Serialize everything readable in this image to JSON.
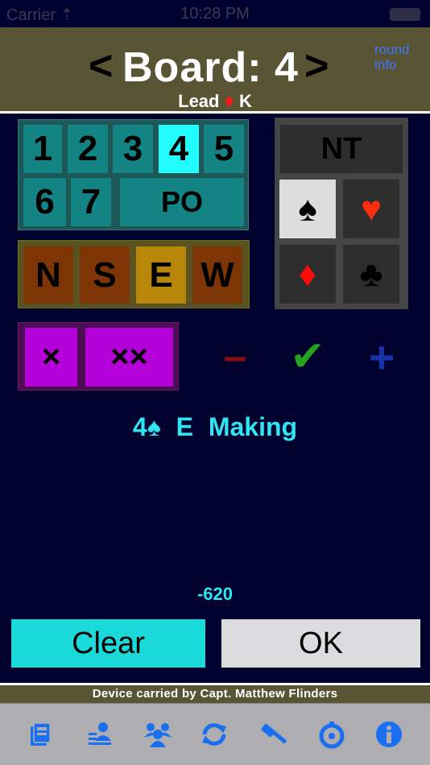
{
  "status_bar": {
    "carrier": "Carrier ⇡",
    "time": "10:28 PM"
  },
  "header": {
    "prev": "<",
    "title": "Board: 4",
    "next": ">",
    "round_info_line1": "round",
    "round_info_line2": "info",
    "lead_label": "Lead",
    "lead_suit": "♦",
    "lead_card": "K"
  },
  "levels": [
    "1",
    "2",
    "3",
    "4",
    "5",
    "6",
    "7"
  ],
  "selected_level": "4",
  "pass_out": "PO",
  "seats": [
    "N",
    "S",
    "E",
    "W"
  ],
  "selected_seat": "E",
  "strains": {
    "nt": "NT",
    "spade": "♠",
    "heart": "♥",
    "diamond": "♦",
    "club": "♣"
  },
  "selected_strain": "spade",
  "doubles": {
    "double": "×",
    "redouble": "××"
  },
  "result_controls": {
    "down": "–",
    "made": "✔",
    "up": "+"
  },
  "contract_text": "4♠  E  Making",
  "score": "-620",
  "buttons": {
    "clear": "Clear",
    "ok": "OK"
  },
  "footer_text": "Device carried by Capt. Matthew Flinders",
  "colors": {
    "accent_teal": "#1ad9d9",
    "selected_level": "#22fdfd",
    "header_olive": "#595433",
    "tab_icon": "#1a6ff0"
  },
  "tabs": [
    {
      "icon": "scorecard-icon"
    },
    {
      "icon": "players-icon"
    },
    {
      "icon": "teams-icon"
    },
    {
      "icon": "sync-icon"
    },
    {
      "icon": "tools-icon"
    },
    {
      "icon": "timer-icon"
    },
    {
      "icon": "info-icon"
    }
  ]
}
